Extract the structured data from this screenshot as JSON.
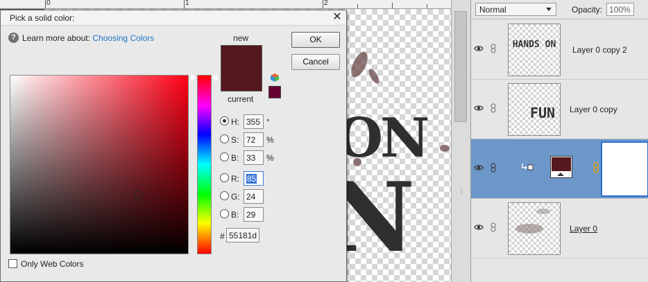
{
  "ruler": {
    "marks": [
      "0",
      "1",
      "2"
    ]
  },
  "canvas": {
    "art_line1": "ON",
    "art_line2": "N"
  },
  "layers_panel": {
    "blend_mode": "Normal",
    "opacity_label": "Opacity:",
    "opacity_value": "100%",
    "layers": [
      {
        "name": "Layer 0 copy 2",
        "thumb_text": "HANDS ON"
      },
      {
        "name": "Layer 0 copy",
        "thumb_text": "FUN"
      },
      {
        "name": "",
        "fill_color": "#55181d"
      },
      {
        "name": "Layer 0",
        "thumb_text": ""
      }
    ]
  },
  "dialog": {
    "title": "Pick a solid color:",
    "close_glyph": "✕",
    "help_prefix": "Learn more about:",
    "help_link": "Choosing Colors",
    "new_label": "new",
    "current_label": "current",
    "ok_label": "OK",
    "cancel_label": "Cancel",
    "only_web_colors_label": "Only Web Colors",
    "new_color": "#55181d",
    "current_color": "#55181d",
    "websafe_color": "#660033",
    "fields": {
      "h": {
        "label": "H:",
        "value": "355",
        "unit": "°"
      },
      "s": {
        "label": "S:",
        "value": "72",
        "unit": "%"
      },
      "b": {
        "label": "B:",
        "value": "33",
        "unit": "%"
      },
      "r": {
        "label": "R:",
        "value": "85"
      },
      "g": {
        "label": "G:",
        "value": "24"
      },
      "bl": {
        "label": "B:",
        "value": "29"
      },
      "hex": {
        "label": "#",
        "value": "55181d"
      }
    }
  }
}
